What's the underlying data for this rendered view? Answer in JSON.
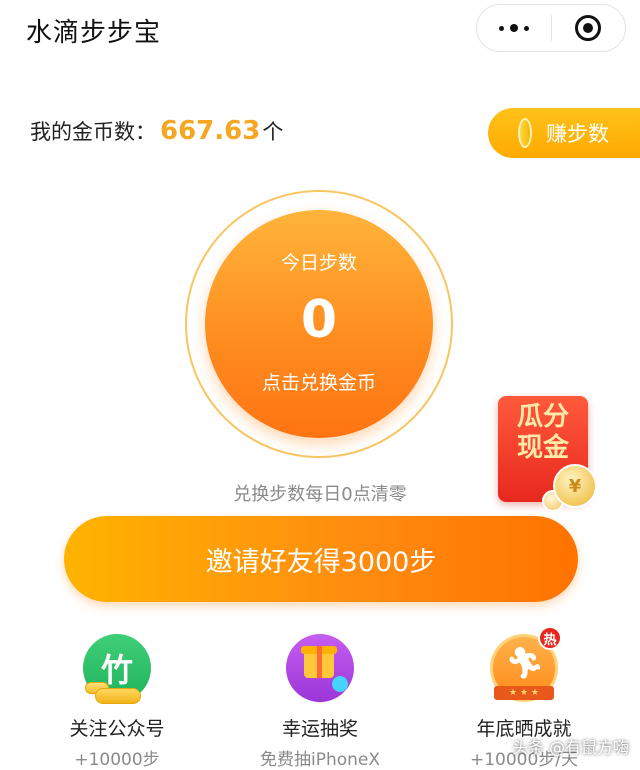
{
  "header": {
    "title": "水滴步步宝"
  },
  "coins": {
    "label": "我的金币数：",
    "value": "667.63",
    "unit": "个",
    "earn_label": "赚步数"
  },
  "steps": {
    "caption": "今日步数",
    "value": "0",
    "action": "点击兑换金币",
    "reset_note": "兑换步数每日0点清零"
  },
  "red_packet": {
    "line1": "瓜分",
    "line2": "现金",
    "coin_symbol": "¥"
  },
  "invite": {
    "label": "邀请好友得3000步"
  },
  "tasks": [
    {
      "title": "关注公众号",
      "sub": "+10000步",
      "icon": "wechat-follow-icon",
      "glyph": "竹"
    },
    {
      "title": "幸运抽奖",
      "sub": "免费抽iPhoneX",
      "icon": "gift-lottery-icon"
    },
    {
      "title": "年底晒成就",
      "sub": "+10000步/天",
      "icon": "runner-achievement-icon",
      "badge": "热",
      "ribbon": "★ ★ ★"
    }
  ],
  "watermark": "头条 @有鼠方嗨",
  "colors": {
    "accent": "#ff8a1e",
    "gold": "#f5a623",
    "red": "#e8281e"
  }
}
